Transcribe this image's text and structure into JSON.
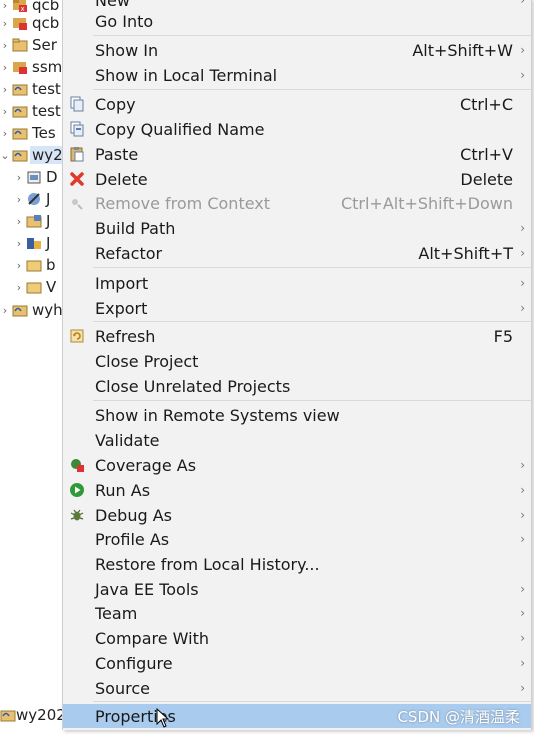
{
  "explorer": {
    "rows": [
      {
        "label": "qcb",
        "icon": "project-error-icon"
      },
      {
        "label": "qcb",
        "icon": "project-error-icon"
      },
      {
        "label": "Ser",
        "icon": "project-folder-icon"
      },
      {
        "label": "ssm",
        "icon": "project-error-icon"
      },
      {
        "label": "test",
        "icon": "project-icon"
      },
      {
        "label": "test",
        "icon": "project-icon"
      },
      {
        "label": "Tes",
        "icon": "project-icon"
      },
      {
        "label": "wy2",
        "icon": "project-icon"
      },
      {
        "label": "D",
        "icon": "deployment-descriptor-icon"
      },
      {
        "label": "J",
        "icon": "jax-ws-icon"
      },
      {
        "label": "J",
        "icon": "java-resources-icon"
      },
      {
        "label": "J",
        "icon": "javascript-resources-icon"
      },
      {
        "label": "b",
        "icon": "folder-icon"
      },
      {
        "label": "V",
        "icon": "folder-icon"
      },
      {
        "label": "wyh",
        "icon": "project-icon"
      }
    ],
    "status_text": "wy202"
  },
  "menu": {
    "items": [
      {
        "label": "New",
        "shortcut": "",
        "submenu": true
      },
      {
        "label": "Go Into",
        "shortcut": "",
        "submenu": false
      },
      {
        "label": "Show In",
        "shortcut": "Alt+Shift+W",
        "submenu": true
      },
      {
        "label": "Show in Local Terminal",
        "shortcut": "",
        "submenu": true
      },
      {
        "label": "Copy",
        "shortcut": "Ctrl+C",
        "submenu": false,
        "icon": "copy-icon"
      },
      {
        "label": "Copy Qualified Name",
        "shortcut": "",
        "submenu": false,
        "icon": "copy-qualified-name-icon"
      },
      {
        "label": "Paste",
        "shortcut": "Ctrl+V",
        "submenu": false,
        "icon": "paste-icon"
      },
      {
        "label": "Delete",
        "shortcut": "Delete",
        "submenu": false,
        "icon": "delete-icon"
      },
      {
        "label": "Remove from Context",
        "shortcut": "Ctrl+Alt+Shift+Down",
        "submenu": false,
        "icon": "remove-context-icon",
        "disabled": true
      },
      {
        "label": "Build Path",
        "shortcut": "",
        "submenu": true
      },
      {
        "label": "Refactor",
        "shortcut": "Alt+Shift+T",
        "submenu": true
      },
      {
        "label": "Import",
        "shortcut": "",
        "submenu": true
      },
      {
        "label": "Export",
        "shortcut": "",
        "submenu": true
      },
      {
        "label": "Refresh",
        "shortcut": "F5",
        "submenu": false,
        "icon": "refresh-icon"
      },
      {
        "label": "Close Project",
        "shortcut": "",
        "submenu": false
      },
      {
        "label": "Close Unrelated Projects",
        "shortcut": "",
        "submenu": false
      },
      {
        "label": "Show in Remote Systems view",
        "shortcut": "",
        "submenu": false
      },
      {
        "label": "Validate",
        "shortcut": "",
        "submenu": false
      },
      {
        "label": "Coverage As",
        "shortcut": "",
        "submenu": true,
        "icon": "coverage-icon"
      },
      {
        "label": "Run As",
        "shortcut": "",
        "submenu": true,
        "icon": "run-icon"
      },
      {
        "label": "Debug As",
        "shortcut": "",
        "submenu": true,
        "icon": "debug-icon"
      },
      {
        "label": "Profile As",
        "shortcut": "",
        "submenu": true
      },
      {
        "label": "Restore from Local History...",
        "shortcut": "",
        "submenu": false
      },
      {
        "label": "Java EE Tools",
        "shortcut": "",
        "submenu": true
      },
      {
        "label": "Team",
        "shortcut": "",
        "submenu": true
      },
      {
        "label": "Compare With",
        "shortcut": "",
        "submenu": true
      },
      {
        "label": "Configure",
        "shortcut": "",
        "submenu": true
      },
      {
        "label": "Source",
        "shortcut": "",
        "submenu": true
      },
      {
        "label": "Properties",
        "shortcut": "",
        "submenu": false,
        "highlighted": true
      }
    ]
  },
  "watermark": "CSDN @清酒温柔",
  "colors": {
    "menu_bg": "#f2f2f2",
    "highlight": "#a9cbee",
    "disabled_text": "#9a9a9a",
    "delete_red": "#e03a2a",
    "run_green": "#2f9a3a"
  }
}
